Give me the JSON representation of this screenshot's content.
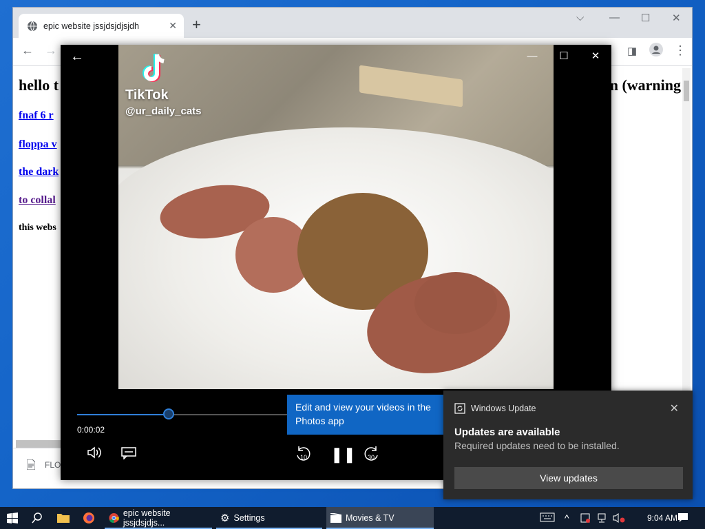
{
  "browser": {
    "tab_title": "epic website jssjdsjdjsjdh",
    "page": {
      "heading_left": "hello t",
      "heading_right": "n (warning",
      "links": [
        "fnaf 6 r",
        "floppa v",
        "the dark",
        "to collal"
      ],
      "small_text": "this webs"
    },
    "download_file": "FLO"
  },
  "player": {
    "app_name": "Movies & TV",
    "tiktok_brand": "TikTok",
    "tiktok_user": "@ur_daily_cats",
    "elapsed_time": "0:00:02",
    "progress_fraction": 0.19,
    "skip_back_label": "10",
    "skip_forward_label": "30",
    "tooltip": "Edit and view your videos in the Photos app",
    "accent_color": "#2f7fd9"
  },
  "notification": {
    "app": "Windows Update",
    "title": "Updates are available",
    "body": "Required updates need to be installed.",
    "button": "View updates"
  },
  "taskbar": {
    "items": [
      {
        "label": "epic website jssjdsjdjs..."
      },
      {
        "label": "Settings"
      },
      {
        "label": "Movies & TV"
      }
    ],
    "clock": "9:04 AM"
  }
}
